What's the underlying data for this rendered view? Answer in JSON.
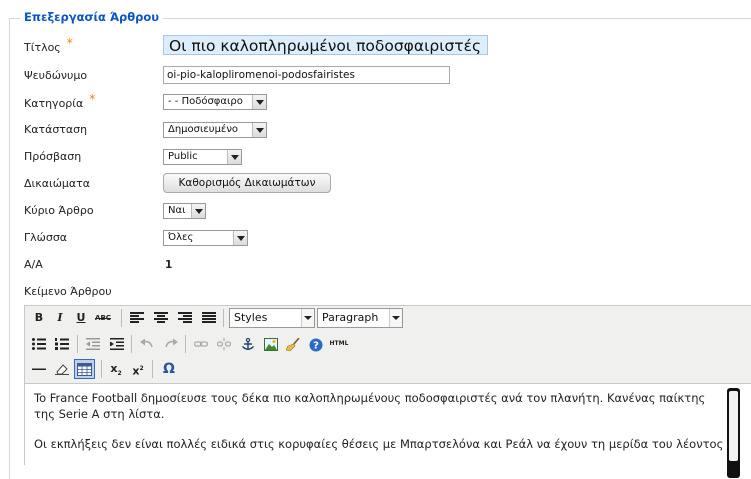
{
  "form": {
    "legend": "Επεξεργασία Άρθρου",
    "required_mark": "*",
    "title_label": "Τίτλος",
    "title_value": "Οι πιο καλοπληρωμένοι ποδοσφαιριστές",
    "alias_label": "Ψευδώνυμο",
    "alias_value": "oi-pio-kaloplirоmenoi-podosfairistes",
    "category_label": "Κατηγορία",
    "category_value": "- - Ποδόσφαιρο",
    "status_label": "Κατάσταση",
    "status_value": "Δημοσιευμένο",
    "access_label": "Πρόσβαση",
    "access_value": "Public",
    "permissions_label": "Δικαιώματα",
    "permissions_button": "Καθορισμός Δικαιωμάτων",
    "featured_label": "Κύριο Άρθρο",
    "featured_value": "Ναι",
    "language_label": "Γλώσσα",
    "language_value": "Όλες",
    "id_label": "Α/Α",
    "id_value": "1",
    "text_label": "Κείμενο Άρθρου"
  },
  "editor": {
    "bold": "B",
    "italic": "I",
    "underline": "U",
    "strike": "ABC",
    "styles_value": "Styles",
    "format_value": "Paragraph",
    "html_label": "HTML",
    "subscript": "x",
    "superscript": "x",
    "omega": "Ω",
    "paragraph1": "To France Football δημοσίευσε τους δέκα πιο καλοπληρωμένους ποδοσφαιριστές ανά τον πλανήτη. Κανένας παίκτης της Serie A στη λίστα.",
    "paragraph2": "Οι εκπλήξεις δεν είναι πολλές ειδικά στις κορυφαίες θέσεις με Μπαρτσελόνα και Ρεάλ να έχουν τη μερίδα του λέοντος στους"
  },
  "colors": {
    "legend": "#0b55c4",
    "required": "#f08000",
    "title_bg": "#dceefb"
  }
}
